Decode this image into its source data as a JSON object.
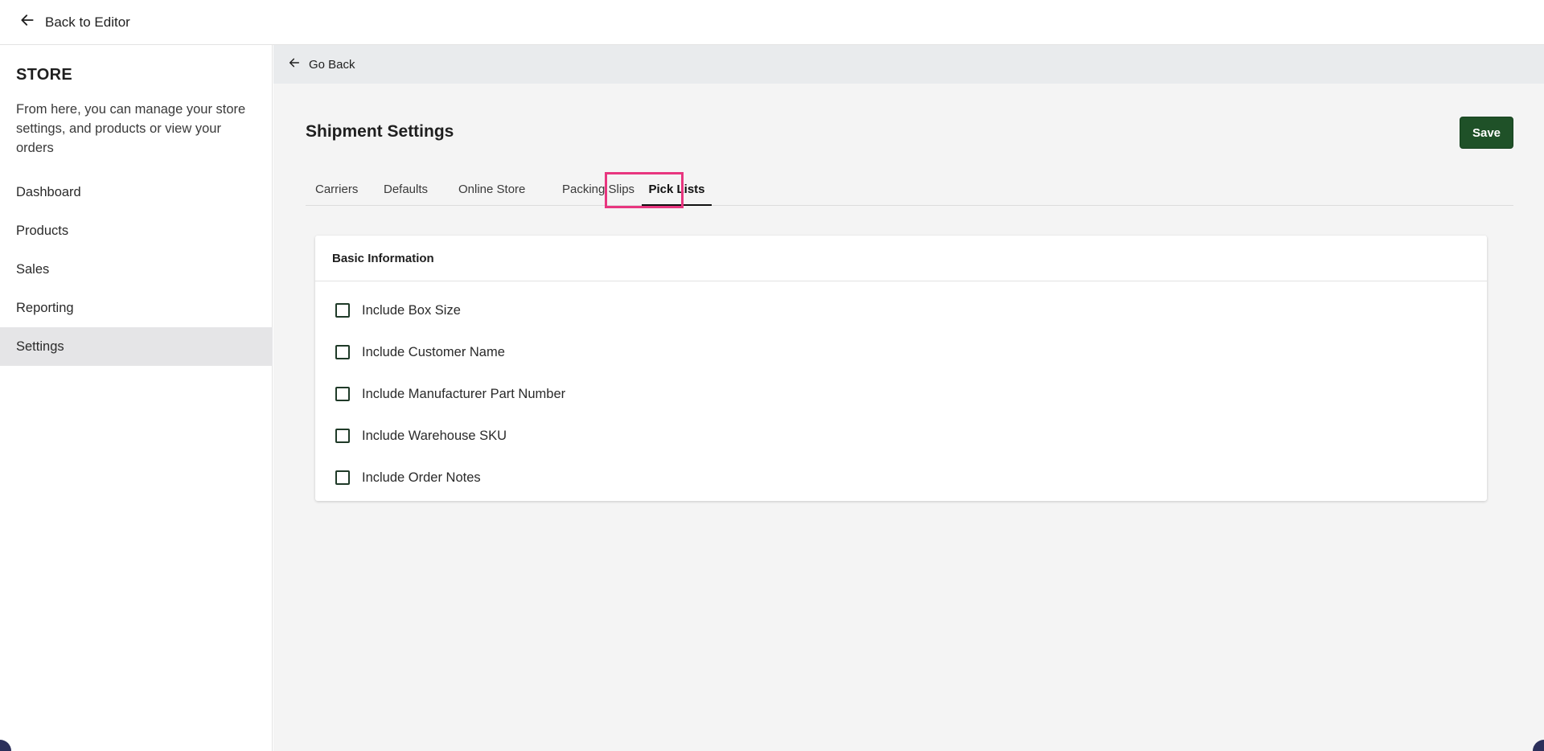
{
  "topbar": {
    "back_label": "Back to Editor"
  },
  "sidebar": {
    "title": "STORE",
    "description": "From here, you can manage your store settings, and products or view your orders",
    "items": [
      {
        "label": "Dashboard"
      },
      {
        "label": "Products"
      },
      {
        "label": "Sales"
      },
      {
        "label": "Reporting"
      },
      {
        "label": "Settings",
        "active": true
      }
    ]
  },
  "main": {
    "go_back_label": "Go Back",
    "title": "Shipment Settings",
    "save_label": "Save",
    "tabs": [
      {
        "label": "Carriers"
      },
      {
        "label": "Defaults"
      },
      {
        "label": "Online Store"
      },
      {
        "label": "Packing Slips"
      },
      {
        "label": "Pick Lists",
        "active": true
      }
    ],
    "card": {
      "title": "Basic Information",
      "options": [
        {
          "label": "Include Box Size",
          "checked": false
        },
        {
          "label": "Include Customer Name",
          "checked": false
        },
        {
          "label": "Include Manufacturer Part Number",
          "checked": false
        },
        {
          "label": "Include Warehouse SKU",
          "checked": false
        },
        {
          "label": "Include Order Notes",
          "checked": false
        }
      ]
    }
  },
  "colors": {
    "save_button": "#1f5128",
    "tab_highlight": "#e8367f",
    "active_nav": "#e5e5e7",
    "main_background": "#f4f4f4",
    "go_back_bar": "#e9ebed"
  }
}
